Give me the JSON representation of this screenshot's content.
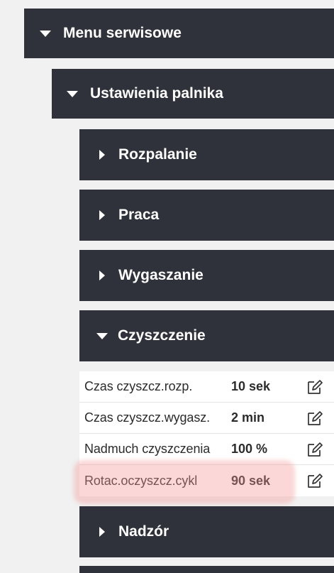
{
  "menu": {
    "title": "Menu serwisowe",
    "burner_settings": {
      "title": "Ustawienia palnika",
      "sections": {
        "ignition": "Rozpalanie",
        "work": "Praca",
        "extinguish": "Wygaszanie",
        "cleaning": "Czyszczenie",
        "supervision": "Nadzór"
      }
    }
  },
  "cleaning_params": [
    {
      "name": "Czas czyszcz.rozp.",
      "value": "10 sek"
    },
    {
      "name": "Czas czyszcz.wygasz.",
      "value": "2 min"
    },
    {
      "name": "Nadmuch czyszczenia",
      "value": "100 %"
    },
    {
      "name": "Rotac.oczyszcz.cykl",
      "value": "90 sek"
    }
  ],
  "icons": {
    "expanded": "triangle-down-icon",
    "collapsed": "triangle-right-icon",
    "edit": "edit-icon"
  },
  "colors": {
    "header_bg": "#2f323a",
    "page_bg": "#f1f1f1",
    "highlight": "#f49696"
  }
}
